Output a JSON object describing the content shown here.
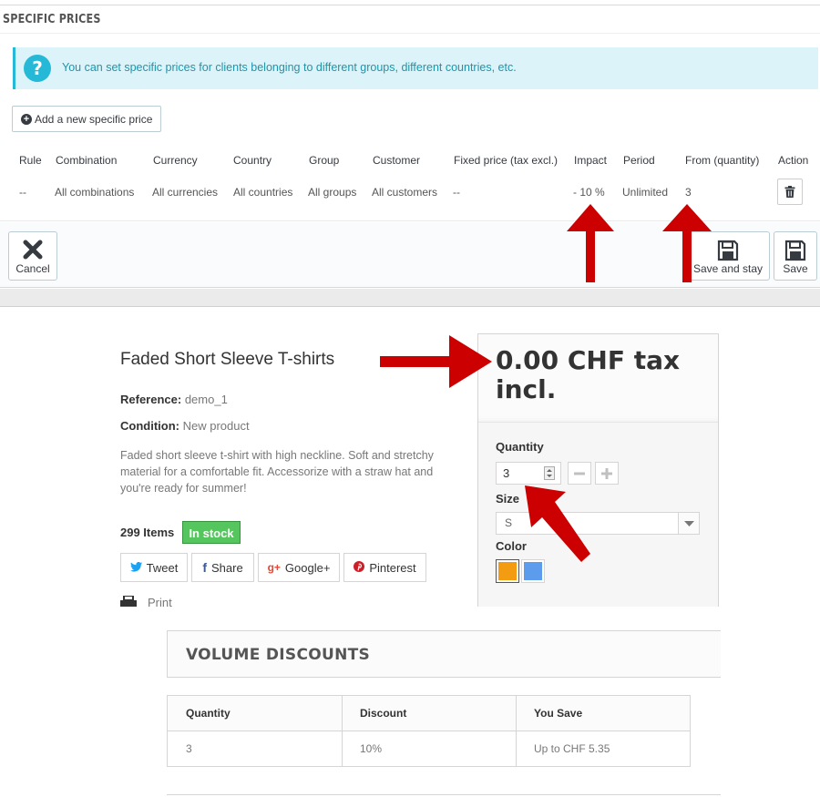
{
  "admin": {
    "heading": "SPECIFIC PRICES",
    "info_alert": "You can set specific prices for clients belonging to different groups, different countries, etc.",
    "add_button": "Add a new specific price",
    "table": {
      "headers": [
        "Rule",
        "Combination",
        "Currency",
        "Country",
        "Group",
        "Customer",
        "Fixed price (tax excl.)",
        "Impact",
        "Period",
        "From (quantity)",
        "Action"
      ],
      "rows": [
        [
          "--",
          "All combinations",
          "All currencies",
          "All countries",
          "All groups",
          "All customers",
          "--",
          "- 10 %",
          "Unlimited",
          "3"
        ]
      ]
    },
    "footer": {
      "cancel": "Cancel",
      "save_and_stay": "Save and stay",
      "save": "Save"
    }
  },
  "product": {
    "title": "Faded Short Sleeve T-shirts",
    "reference_label": "Reference:",
    "reference_value": "demo_1",
    "condition_label": "Condition:",
    "condition_value": "New product",
    "description": "Faded short sleeve t-shirt with high neckline. Soft and stretchy material for a comfortable fit. Accessorize with a straw hat and you're ready for summer!",
    "items": "299 Items",
    "stock_badge": "In stock",
    "social": [
      {
        "icon": "twitter-icon",
        "label": "Tweet"
      },
      {
        "icon": "facebook-icon",
        "label": "Share"
      },
      {
        "icon": "google-plus-icon",
        "label": "Google+"
      },
      {
        "icon": "pinterest-icon",
        "label": "Pinterest"
      }
    ],
    "print": "Print",
    "price": "0.00 CHF tax incl.",
    "quantity_label": "Quantity",
    "quantity_value": "3",
    "size_label": "Size",
    "size_value": "S",
    "color_label": "Color",
    "colors": [
      "#f39c11",
      "#5d9cec"
    ]
  },
  "volume_discounts": {
    "title": "VOLUME DISCOUNTS",
    "headers": [
      "Quantity",
      "Discount",
      "You Save"
    ],
    "rows": [
      [
        "3",
        "10%",
        "Up to CHF 5.35"
      ]
    ]
  },
  "colors": {
    "accent": "#25b9d7",
    "annotation_arrow": "#cc0000",
    "stock_green": "#55c65e"
  }
}
